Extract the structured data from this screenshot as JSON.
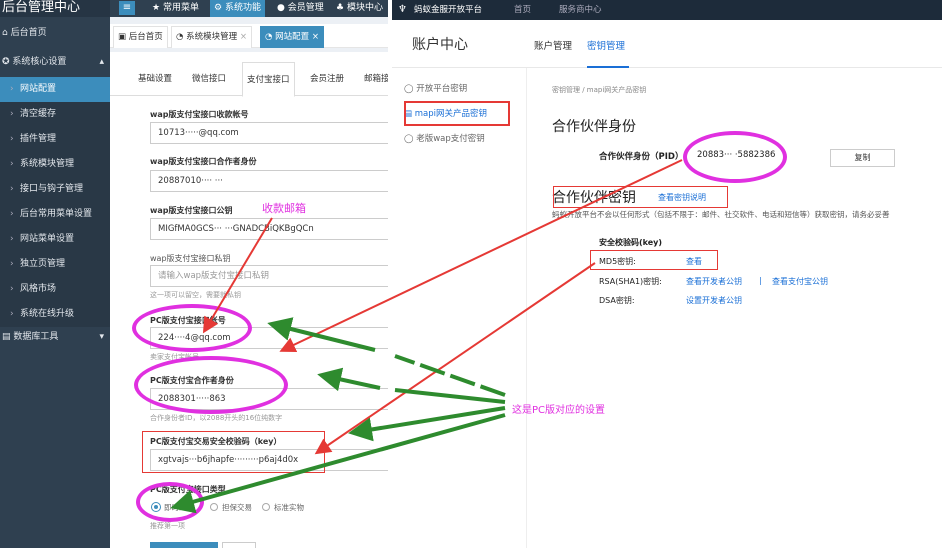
{
  "admin": {
    "title": "后台管理中心",
    "topmenu": [
      "常用菜单",
      "系统功能",
      "会员管理",
      "模块中心"
    ],
    "sidebar": {
      "home": "后台首页",
      "group": "系统核心设置",
      "items": [
        "网站配置",
        "清空缓存",
        "插件管理",
        "系统模块管理",
        "接口与钩子管理",
        "后台常用菜单设置",
        "网站菜单设置",
        "独立页管理",
        "风格市场",
        "系统在线升级"
      ],
      "db": "数据库工具"
    },
    "tabs": [
      "后台首页",
      "系统模块管理",
      "网站配置"
    ],
    "subtabs": [
      "基础设置",
      "微信接口",
      "支付宝接口",
      "会员注册",
      "邮箱接"
    ],
    "fields": {
      "wap_account_label": "wap版支付宝接口收款帐号",
      "wap_account_value": "10713·····@qq.com",
      "wap_pid_label": "wap版支付宝接口合作者身份",
      "wap_pid_value": "20887010···· ···",
      "wap_pubkey_label": "wap版支付宝接口公钥",
      "wap_pubkey_value": "MIGfMA0GCS··· ···GNADCBiQKBgQCn",
      "wap_privkey_label": "wap版支付宝接口私钥",
      "wap_privkey_placeholder": "请输入wap版支付宝接口私钥",
      "wap_privkey_help": "这一项可以留空，需要就私钥",
      "pc_account_label": "PC版支付宝接口帐号",
      "pc_account_value": "224····4@qq.com",
      "pc_account_help": "卖家支付宝帐号",
      "pc_pid_label": "PC版支付宝合作者身份",
      "pc_pid_value": "2088301·····863",
      "pc_pid_help": "合作身份者ID，以2088开头的16位纯数字",
      "pc_key_label": "PC版支付宝交易安全校验码（key）",
      "pc_key_value": "xgtvajs···b6jhapfe·········p6aj4d0x",
      "pc_type_label": "PC版支付宝接口类型",
      "pc_type_options": [
        "即时到帐",
        "担保交易",
        "标准实物"
      ],
      "pc_type_help": "推荐第一项"
    }
  },
  "alipay": {
    "platform": "蚂蚁金服开放平台",
    "topnav": [
      "首页",
      "服务商中心"
    ],
    "header_title": "账户中心",
    "header_tabs": [
      "账户管理",
      "密钥管理"
    ],
    "side": [
      "开放平台密钥",
      "mapi网关产品密钥",
      "老版wap支付密钥"
    ],
    "breadcrumb": "密钥管理 / mapi网关产品密钥",
    "partner_title": "合作伙伴身份",
    "pid_label": "合作伙伴身份（PID）",
    "pid_value": "20883··· ·5882386",
    "copy": "复制",
    "key_title": "合作伙伴密钥",
    "key_link": "查看密钥说明",
    "key_note": "蚂蚁开放平台不会以任何形式（包括不限于：邮件、社交软件、电话和短信等）获取密钥，请务必妥善",
    "security_label": "安全校验码(key)",
    "md5_label": "MD5密钥:",
    "md5_action": "查看",
    "rsa_label": "RSA(SHA1)密钥:",
    "rsa_action1": "查看开发者公钥",
    "rsa_sep": "|",
    "rsa_action2": "查看支付宝公钥",
    "dsa_label": "DSA密钥:",
    "dsa_action": "设置开发者公钥"
  },
  "annotations": {
    "email": "收款邮箱",
    "pc_note": "这是PC版对应的设置"
  },
  "colors": {
    "admin_sidebar": "#2f4050",
    "admin_accent": "#3c8dbc",
    "highlight_ellipse": "#e030e0",
    "red_box": "#e53935",
    "green_arrow": "#2e8b2e",
    "alipay_blue": "#1a6fd6"
  }
}
